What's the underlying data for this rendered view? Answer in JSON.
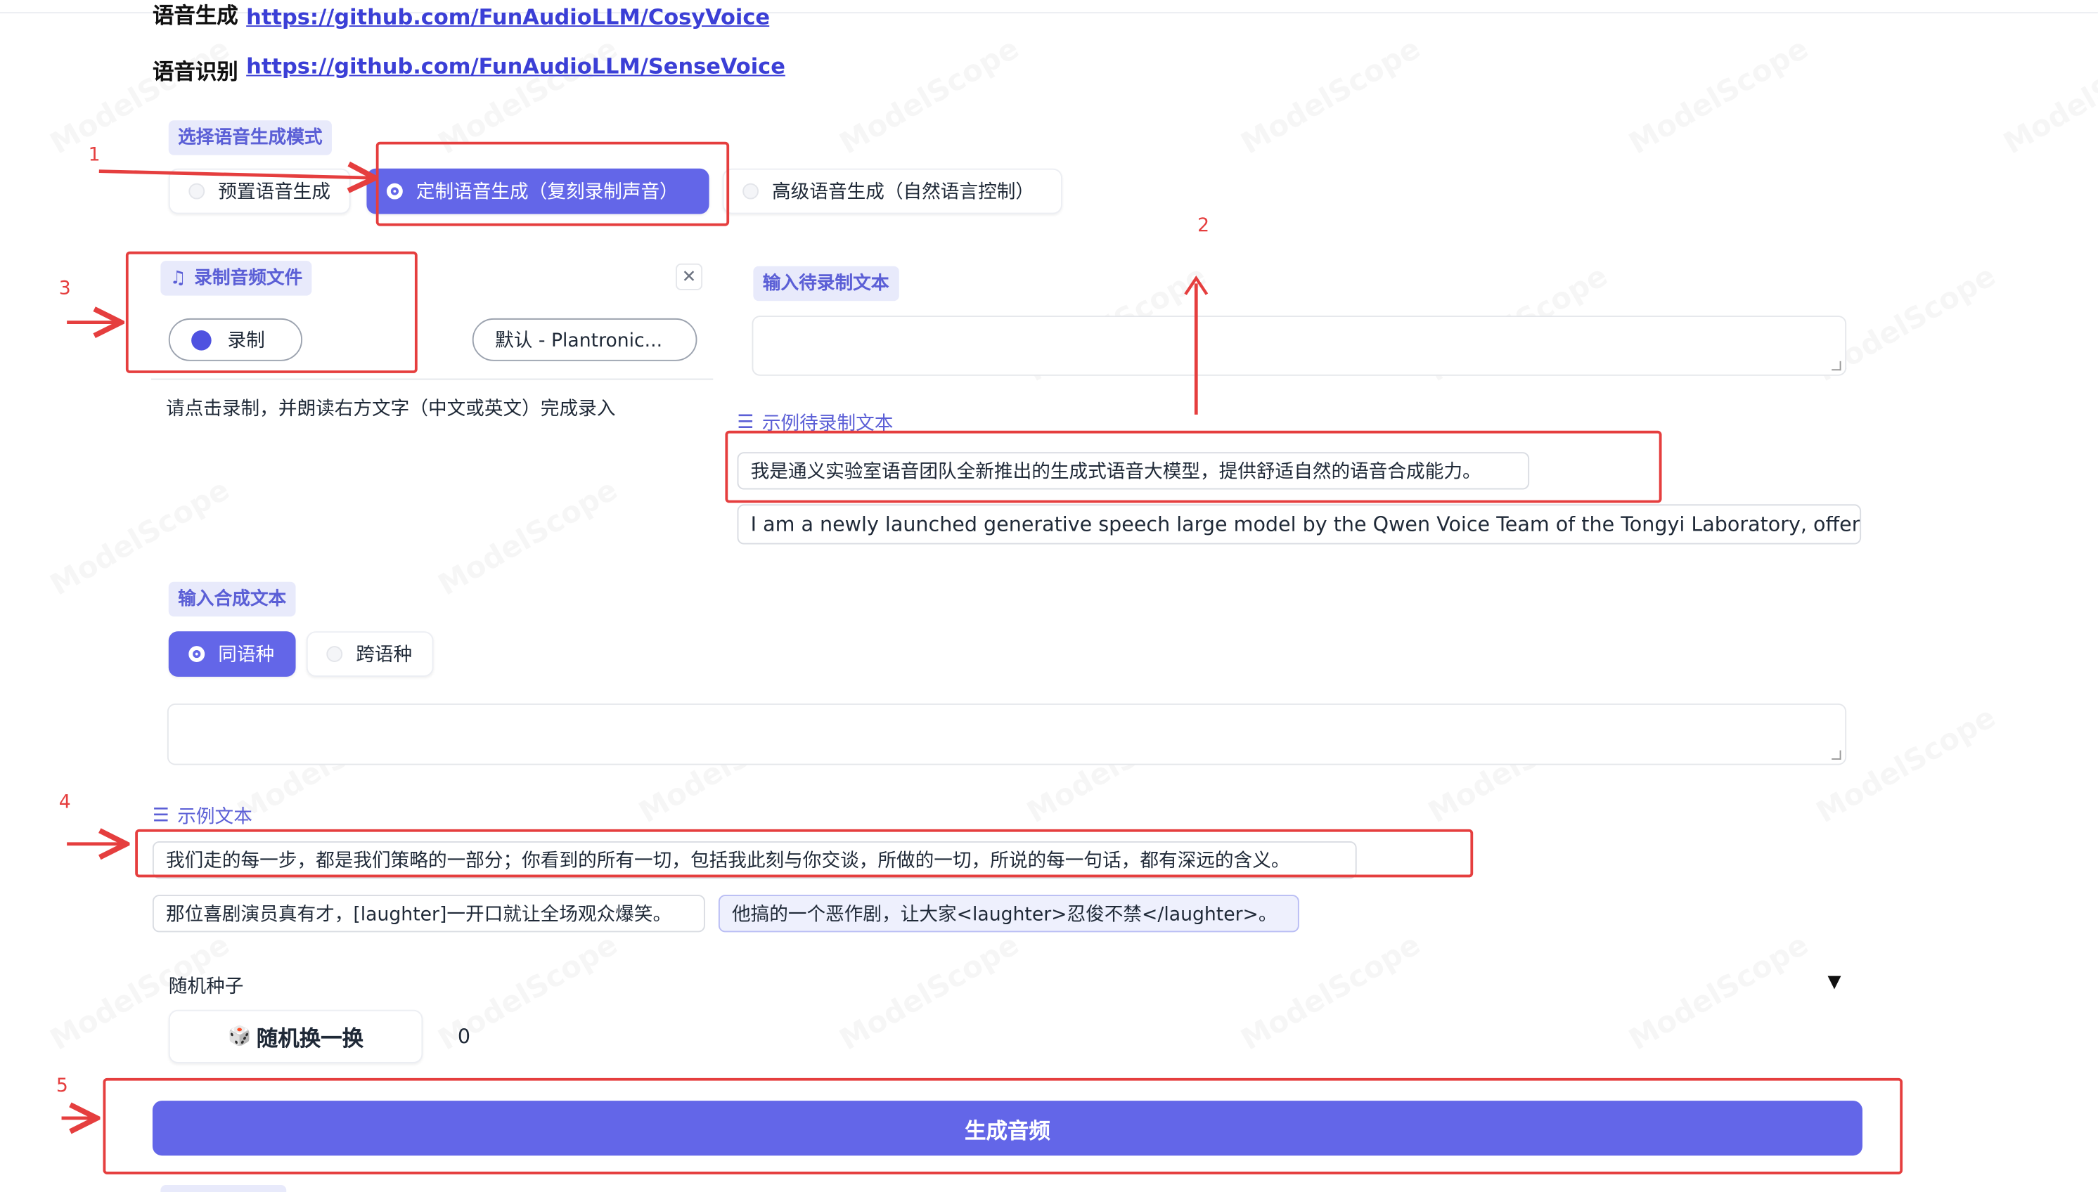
{
  "links": {
    "tts_label": "语音生成",
    "tts_url": "https://github.com/FunAudioLLM/CosyVoice",
    "asr_label": "语音识别",
    "asr_url": "https://github.com/FunAudioLLM/SenseVoice"
  },
  "mode": {
    "label": "选择语音生成模式",
    "options": [
      "预置语音生成",
      "定制语音生成（复刻录制声音）",
      "高级语音生成（自然语言控制）"
    ],
    "selected_index": 1
  },
  "record": {
    "label": "录制音频文件",
    "record_button": "录制",
    "device": "默认 - Plantronic...",
    "hint": "请点击录制，并朗读右方文字（中文或英文）完成录入"
  },
  "record_text": {
    "label": "输入待录制文本",
    "value": "",
    "examples_label": "示例待录制文本",
    "examples": [
      "我是通义实验室语音团队全新推出的生成式语音大模型，提供舒适自然的语音合成能力。",
      "I am a newly launched generative speech large model by the Qwen Voice Team of the Tongyi Laboratory, offering"
    ]
  },
  "synth_text": {
    "label": "输入合成文本",
    "lang_options": [
      "同语种",
      "跨语种"
    ],
    "lang_selected_index": 0,
    "value": "",
    "examples_label": "示例文本",
    "examples": [
      "我们走的每一步，都是我们策略的一部分；你看到的所有一切，包括我此刻与你交谈，所做的一切，所说的每一句话，都有深远的含义。",
      "那位喜剧演员真有才，[laughter]一开口就让全场观众爆笑。",
      "他搞的一个恶作剧，让大家<laughter>忍俊不禁</laughter>。"
    ]
  },
  "seed": {
    "label": "随机种子",
    "button": "随机换一换",
    "button_icon": "🎲",
    "value": "0"
  },
  "generate_button": "生成音频",
  "annotations": {
    "numbers": [
      "1",
      "2",
      "3",
      "4",
      "5"
    ],
    "color": "#e53e3e"
  },
  "watermark": "ModelScope",
  "colors": {
    "accent": "#6366e8",
    "chip_bg": "#e8eafb",
    "link": "#3b3fd6"
  }
}
